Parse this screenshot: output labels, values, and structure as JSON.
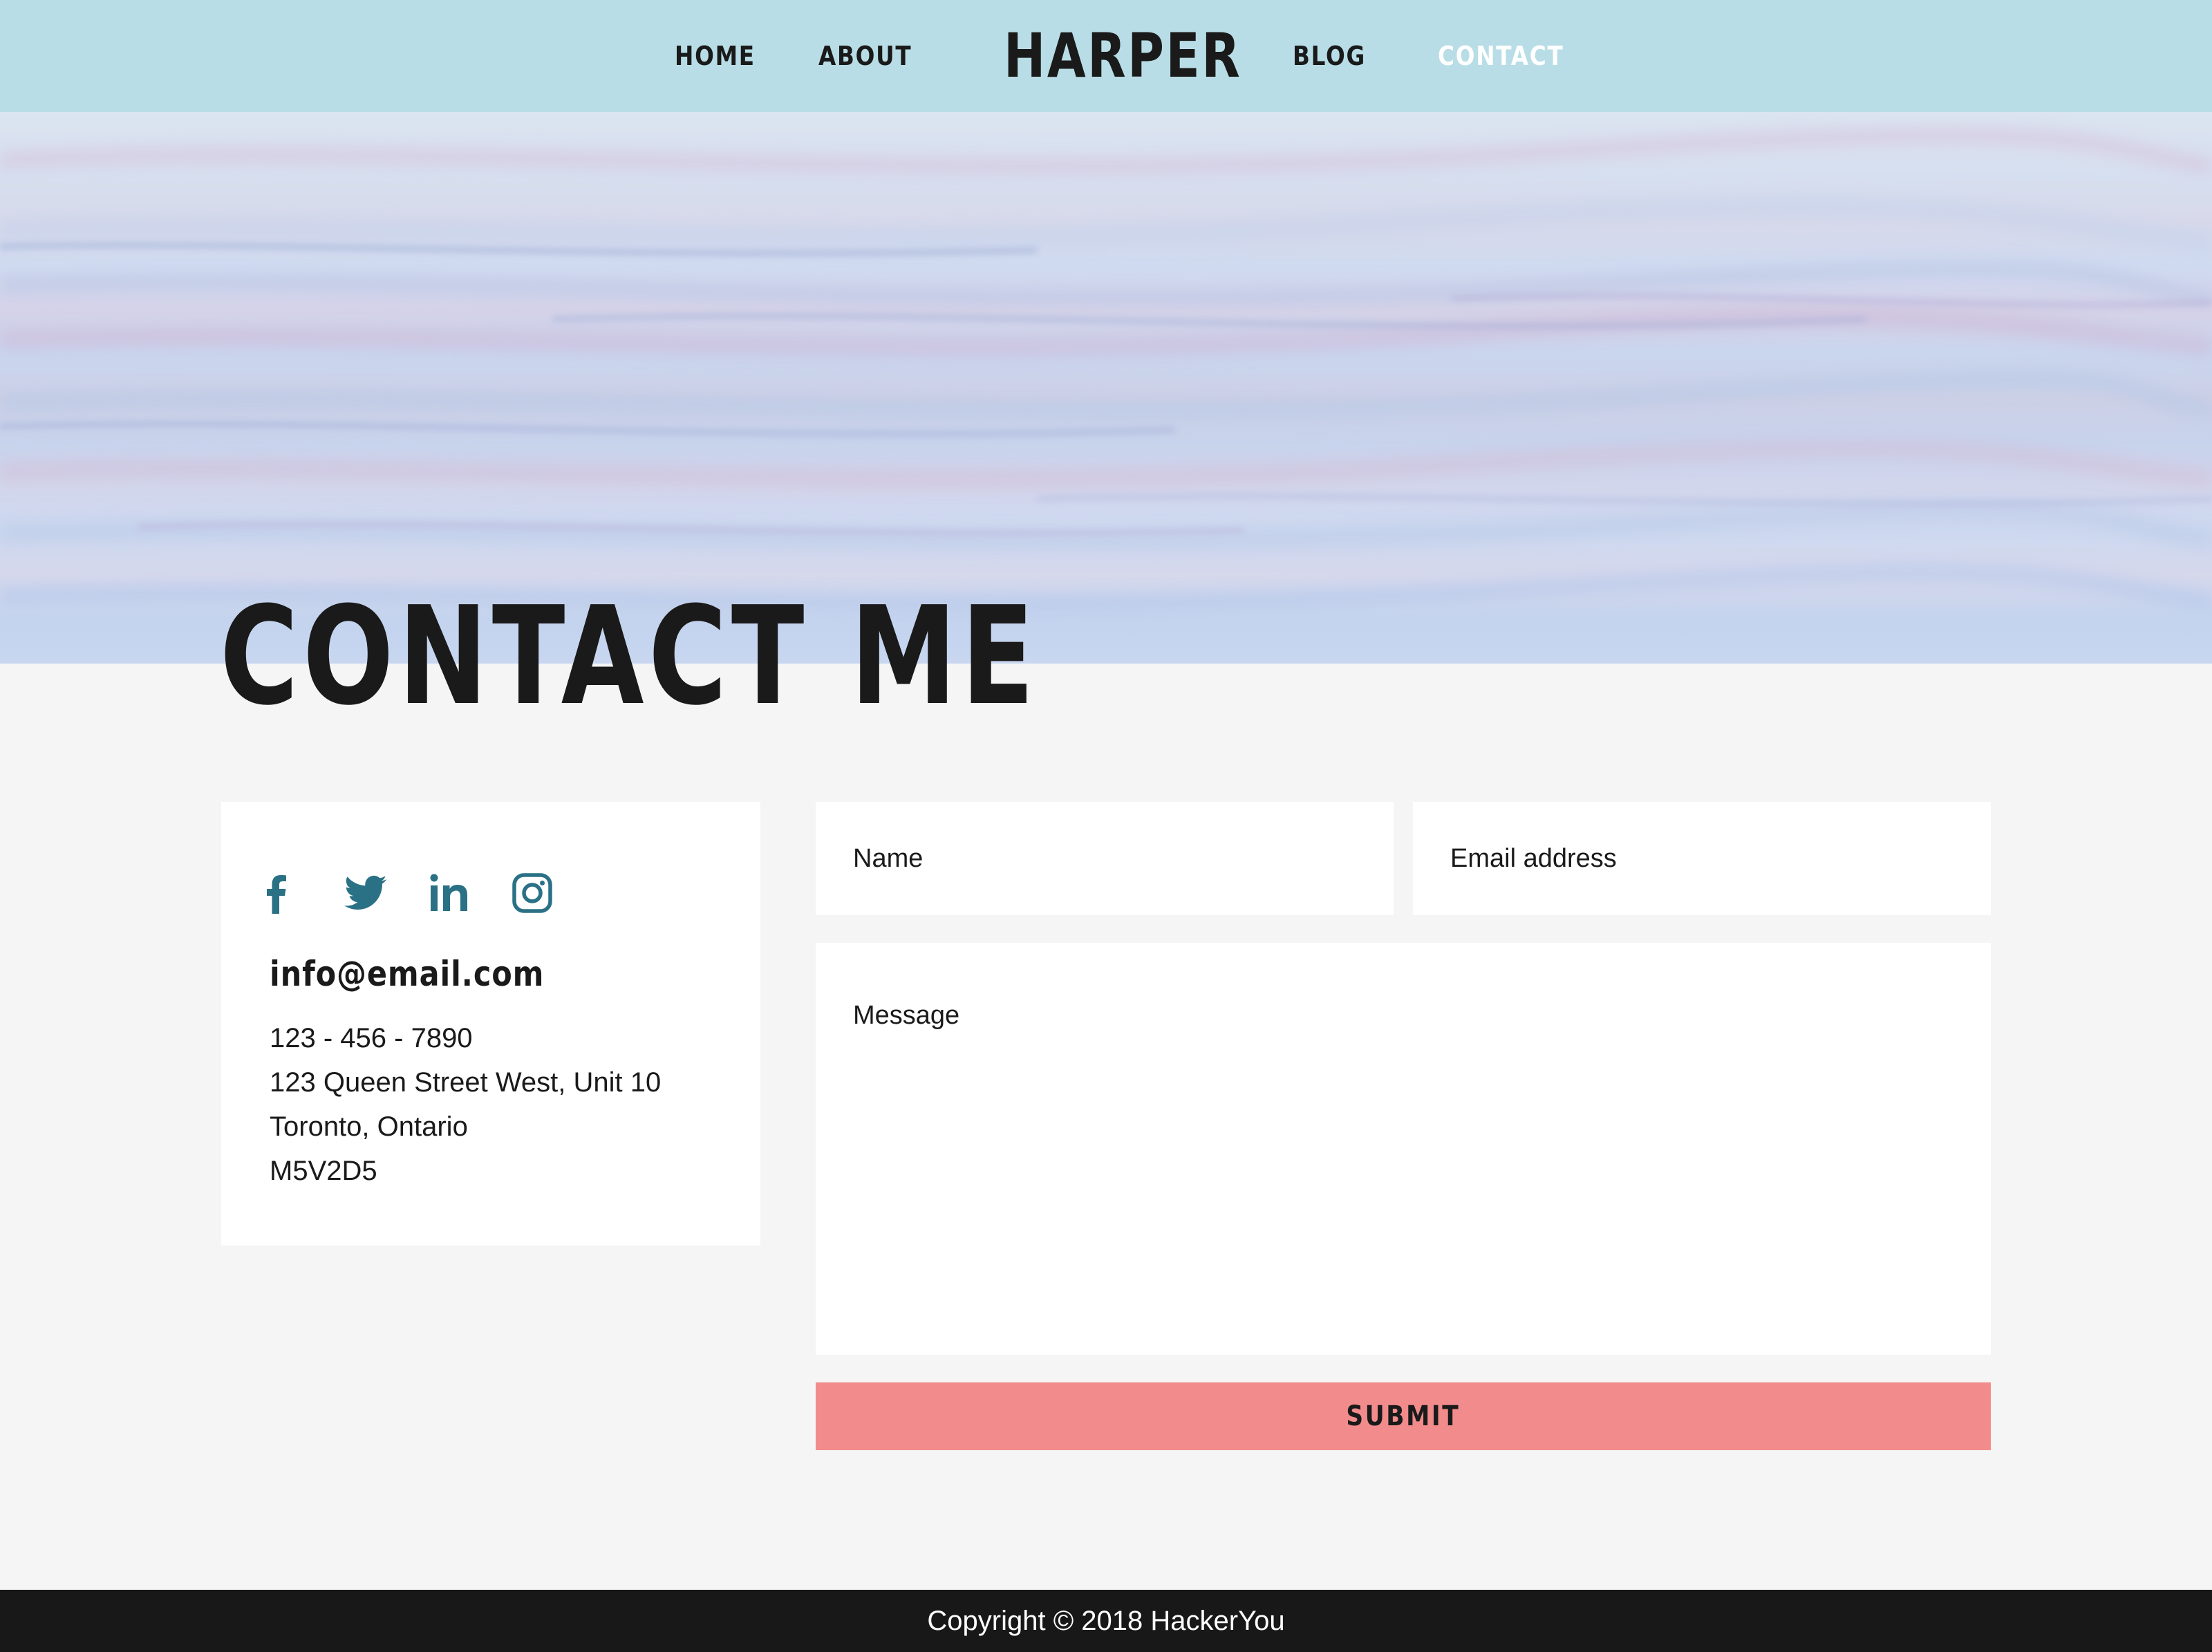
{
  "nav": {
    "logo": "HARPER",
    "items": [
      {
        "label": "HOME"
      },
      {
        "label": "ABOUT"
      },
      {
        "label": "BLOG"
      },
      {
        "label": "CONTACT",
        "active": true
      }
    ]
  },
  "page": {
    "title": "CONTACT ME"
  },
  "contact_info": {
    "social_icons": [
      "facebook-icon",
      "twitter-icon",
      "linkedin-icon",
      "instagram-icon"
    ],
    "email": "info@email.com",
    "phone": "123 - 456 - 7890",
    "street": "123 Queen Street West, Unit 10",
    "city": "Toronto, Ontario",
    "postal_code": "M5V2D5"
  },
  "form": {
    "name_placeholder": "Name",
    "email_placeholder": "Email address",
    "message_placeholder": "Message",
    "submit_label": "SUBMIT"
  },
  "footer": {
    "copyright": "Copyright © 2018 HackerYou"
  },
  "colors": {
    "header_bg": "#b8dde6",
    "active_nav": "#ffffff",
    "icon": "#2a7186",
    "submit_bg": "#f28b8b",
    "footer_bg": "#181818",
    "page_bg": "#f5f5f5"
  }
}
